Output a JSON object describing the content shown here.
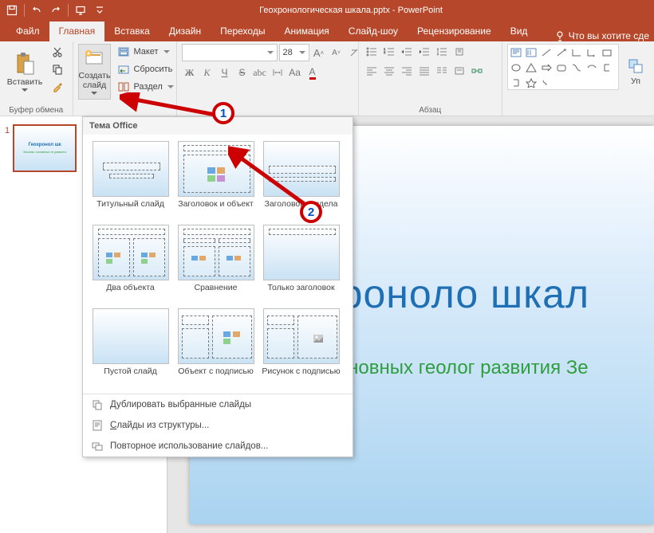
{
  "app": {
    "title": "Геохронологическая шкала.pptx - PowerPoint"
  },
  "tabs": {
    "file": "Файл",
    "home": "Главная",
    "insert": "Вставка",
    "design": "Дизайн",
    "transitions": "Переходы",
    "animations": "Анимация",
    "slideshow": "Слайд-шоу",
    "review": "Рецензирование",
    "view": "Вид",
    "tellme": "Что вы хотите сде"
  },
  "ribbon": {
    "clipboard": {
      "label": "Буфер обмена",
      "paste": "Вставить"
    },
    "slides": {
      "new_slide": "Создать слайд",
      "layout_btn": "Макет",
      "reset": "Сбросить",
      "section": "Раздел"
    },
    "font": {
      "size": "28",
      "placeholder": ""
    },
    "paragraph": {
      "label": "Абзац"
    },
    "drawing": {
      "arrange": "Уп"
    }
  },
  "layout_menu": {
    "header": "Тема Office",
    "items": [
      "Титульный слайд",
      "Заголовок и объект",
      "Заголовок раздела",
      "Два объекта",
      "Сравнение",
      "Только заголовок",
      "Пустой слайд",
      "Объект с подписью",
      "Рисунок с подписью"
    ],
    "footer": {
      "duplicate": "Дублировать выбранные слайды",
      "outline": "Слайды из структуры...",
      "reuse": "Повторное использование слайдов..."
    }
  },
  "thumbs": {
    "num1": "1",
    "t_title": "Геохронол шк",
    "t_sub": "Восемь основных ге развити"
  },
  "slide": {
    "title": "Геохроноло шкал",
    "subtitle": "Восемь основных геолог развития Зе"
  },
  "markers": {
    "m1": "1",
    "m2": "2"
  }
}
